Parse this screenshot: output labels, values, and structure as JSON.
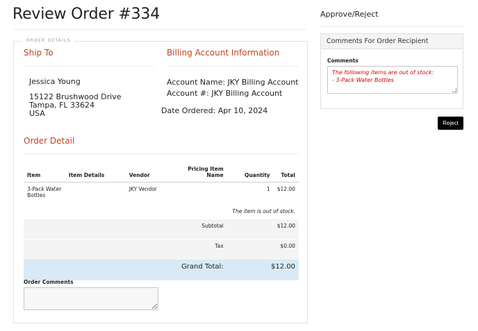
{
  "page": {
    "title": "Review Order #334"
  },
  "order_details": {
    "legend": "ORDER DETAILS",
    "ship_to": {
      "heading": "Ship To",
      "name": "Jessica Young",
      "street": "15122 Brushwood Drive",
      "city_state_zip": "Tampa, FL 33624",
      "country": "USA"
    },
    "billing": {
      "heading": "Billing Account Information",
      "account_name": "Account Name: JKY Billing Account",
      "account_number": "Account #: JKY Billing Account",
      "date_ordered": "Date Ordered: Apr 10, 2024"
    },
    "order_detail": {
      "heading": "Order Detail",
      "columns": [
        "Item",
        "Item Details",
        "Vendor",
        "Pricing Item Name",
        "Quantity",
        "Total"
      ],
      "items": [
        {
          "item": "3-Pack Water Bottles",
          "details": "",
          "vendor": "JKY Vendor",
          "pricing_name": "",
          "quantity": "1",
          "total": "$12.00",
          "message": "The item is out of stock."
        }
      ],
      "subtotal_label": "Subtotal",
      "subtotal_value": "$12.00",
      "tax_label": "Tax",
      "tax_value": "$0.00",
      "grand_total_label": "Grand Total:",
      "grand_total_value": "$12.00"
    },
    "order_comments": {
      "label": "Order Comments",
      "value": ""
    }
  },
  "approve_reject": {
    "title": "Approve/Reject",
    "panel_title": "Comments For Order Recipient",
    "comments_label": "Comments",
    "comments_lines": [
      "The following items are out of stock:",
      "- 3-Pack Water Bottles"
    ],
    "reject_label": "Reject"
  },
  "colors": {
    "accent": "#c0441f",
    "error": "#d40000",
    "grand_total_bg": "#d8eaf5",
    "button": "#000000"
  }
}
